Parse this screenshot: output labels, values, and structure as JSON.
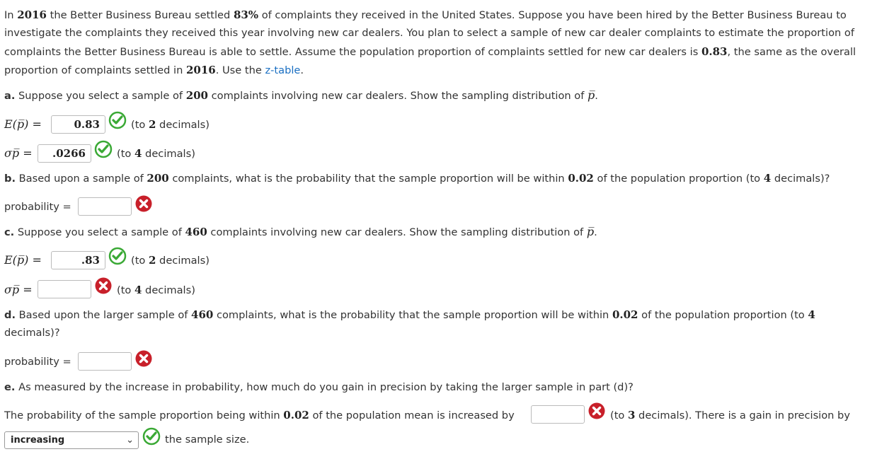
{
  "intro_lines": [
    [
      {
        "t": "In "
      },
      {
        "m": "2016"
      },
      {
        "t": " the Better Business Bureau settled "
      },
      {
        "m": "83%"
      },
      {
        "t": " of complaints they received in the United States. Suppose you have been hired by the Better Business Bureau to"
      }
    ],
    [
      {
        "t": "investigate the complaints they received this year involving new car dealers. You plan to select a sample of new car dealer complaints to estimate the proportion of"
      }
    ],
    [
      {
        "t": "complaints the Better Business Bureau is able to settle. Assume the population proportion of complaints settled for new car dealers is "
      },
      {
        "m": "0.83"
      },
      {
        "t": ", the same as the overall"
      }
    ],
    [
      {
        "t": "proportion of complaints settled in "
      },
      {
        "m": "2016"
      },
      {
        "t": ". Use the "
      },
      {
        "l": "z-table"
      },
      {
        "t": "."
      }
    ]
  ],
  "part_a": {
    "label": "a.",
    "lines": [
      [
        {
          "t": " Suppose you select a sample of "
        },
        {
          "m": "200"
        },
        {
          "t": " complaints involving new car dealers. Show the sampling distribution of "
        },
        {
          "mi": "p̅"
        },
        {
          "t": "."
        }
      ]
    ],
    "mean_label": "E(p̅) =",
    "mean_value": "0.83",
    "mean_note_pre": "(to ",
    "mean_note_num": "2",
    "mean_note_post": " decimals)",
    "sd_label": "σp̅ =",
    "sd_value": ".0266",
    "sd_note_pre": "(to ",
    "sd_note_num": "4",
    "sd_note_post": " decimals)"
  },
  "part_b": {
    "label": "b.",
    "lines": [
      [
        {
          "t": " Based upon a sample of "
        },
        {
          "m": "200"
        },
        {
          "t": " complaints, what is the probability that the sample proportion will be within "
        },
        {
          "m": "0.02"
        },
        {
          "t": " of the population proportion (to "
        },
        {
          "m": "4"
        },
        {
          "t": " decimals)?"
        }
      ]
    ],
    "prob_label": "probability =",
    "prob_value": ""
  },
  "part_c": {
    "label": "c.",
    "lines": [
      [
        {
          "t": " Suppose you select a sample of "
        },
        {
          "m": "460"
        },
        {
          "t": " complaints involving new car dealers. Show the sampling distribution of "
        },
        {
          "mi": "p̅"
        },
        {
          "t": "."
        }
      ]
    ],
    "mean_label": "E(p̅) =",
    "mean_value": ".83",
    "mean_note_pre": "(to ",
    "mean_note_num": "2",
    "mean_note_post": " decimals)",
    "sd_label": "σp̅ =",
    "sd_value": "",
    "sd_note_pre": "(to ",
    "sd_note_num": "4",
    "sd_note_post": " decimals)"
  },
  "part_d": {
    "label": "d.",
    "lines": [
      [
        {
          "t": " Based upon the larger sample of "
        },
        {
          "m": "460"
        },
        {
          "t": " complaints, what is the probability that the sample proportion will be within "
        },
        {
          "m": "0.02"
        },
        {
          "t": " of the population proportion (to "
        },
        {
          "m": "4"
        }
      ],
      [
        {
          "t": "decimals)?"
        }
      ]
    ],
    "prob_label": "probability =",
    "prob_value": ""
  },
  "part_e": {
    "label": "e.",
    "lines": [
      [
        {
          "t": " As measured by the increase in probability, how much do you gain in precision by taking the larger sample in part (d)?"
        }
      ]
    ],
    "sentence_pre": "The probability of the sample proportion being within ",
    "sentence_num": "0.02",
    "sentence_mid": " of the population mean is increased by",
    "increase_value": "",
    "note_pre": "(to ",
    "note_num": "3",
    "note_post": " decimals). There is a gain in precision by",
    "select_value": "increasing",
    "tail": "the sample size."
  },
  "colors": {
    "correct": "#3aa935",
    "incorrect": "#c8202a",
    "link": "#1a6fc2"
  }
}
